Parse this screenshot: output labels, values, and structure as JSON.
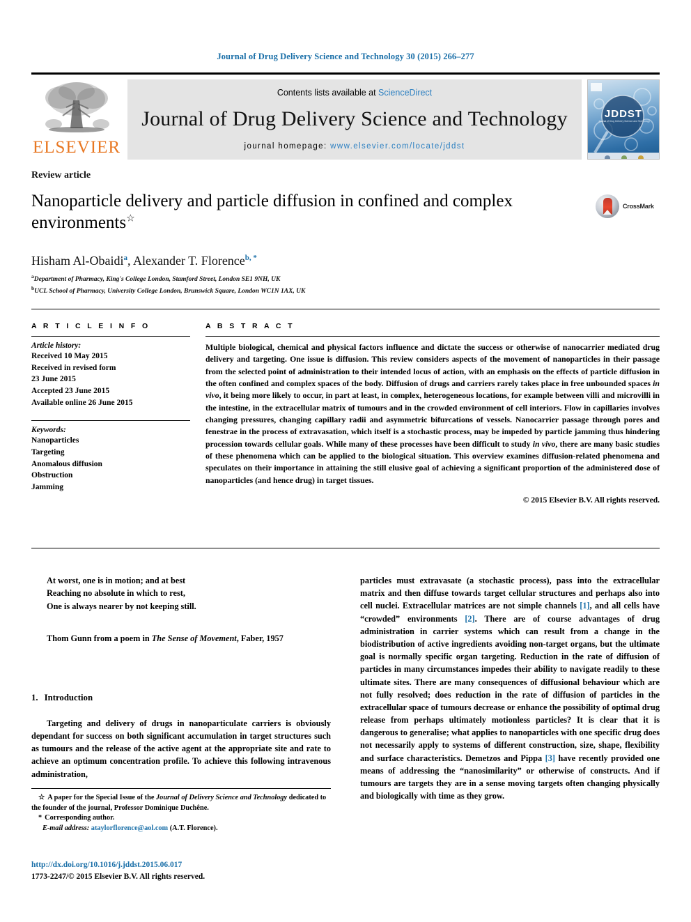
{
  "running_head": "Journal of Drug Delivery Science and Technology 30 (2015) 266–277",
  "masthead": {
    "publisher_name": "ELSEVIER",
    "publisher_logo_icon": "elsevier-tree-icon",
    "contents_prefix": "Contents lists available at ",
    "contents_link": "ScienceDirect",
    "journal_name": "Journal of Drug Delivery Science and Technology",
    "homepage_label": "journal homepage: ",
    "homepage_url": "www.elsevier.com/locate/jddst",
    "cover_title": "JDDST",
    "cover_subtitle": "Journal of Drug Delivery Science and Technology"
  },
  "article": {
    "type": "Review article",
    "title": "Nanoparticle delivery and particle diffusion in confined and complex environments",
    "title_footnote_marker": "☆",
    "crossmark_label": "CrossMark",
    "authors": [
      {
        "name": "Hisham Al-Obaidi",
        "marks": "a"
      },
      {
        "name": "Alexander T. Florence",
        "marks": "b, *"
      }
    ],
    "authors_line_separator": ", ",
    "affiliations": [
      {
        "marker": "a",
        "text": "Department of Pharmacy, King's College London, Stamford Street, London SE1 9NH, UK"
      },
      {
        "marker": "b",
        "text": "UCL School of Pharmacy, University College London, Brunswick Square, London WC1N 1AX, UK"
      }
    ]
  },
  "article_info": {
    "heading": "A R T I C L E  I N F O",
    "history_label": "Article history:",
    "history": [
      "Received 10 May 2015",
      "Received in revised form",
      "23 June 2015",
      "Accepted 23 June 2015",
      "Available online 26 June 2015"
    ],
    "keywords_label": "Keywords:",
    "keywords": [
      "Nanoparticles",
      "Targeting",
      "Anomalous diffusion",
      "Obstruction",
      "Jamming"
    ]
  },
  "abstract": {
    "heading": "A B S T R A C T",
    "paragraph_1": "Multiple biological, chemical and physical factors influence and dictate the success or otherwise of nanocarrier mediated drug delivery and targeting. One issue is diffusion. This review considers aspects of the movement of nanoparticles in their passage from the selected point of administration to their intended locus of action, with an emphasis on the effects of particle diffusion in the often confined and complex spaces of the body. Diffusion of drugs and carriers rarely takes place in free unbounded spaces ",
    "italic_1": "in vivo",
    "paragraph_2": ", it being more likely to occur, in part at least, in complex, heterogeneous locations, for example between villi and microvilli in the intestine, in the extracellular matrix of tumours and in the crowded environment of cell interiors. Flow in capillaries involves changing pressures, changing capillary radii and asymmetric bifurcations of vessels. Nanocarrier passage through pores and fenestrae in the process of extravasation, which itself is a stochastic process, may be impeded by particle jamming thus hindering procession towards cellular goals. While many of these processes have been difficult to study ",
    "italic_2": "in vivo",
    "paragraph_3": ", there are many basic studies of these phenomena which can be applied to the biological situation. This overview examines diffusion-related phenomena and speculates on their importance in attaining the still elusive goal of achieving a significant proportion of the administered dose of nanoparticles (and hence drug) in target tissues.",
    "copyright": "© 2015 Elsevier B.V. All rights reserved."
  },
  "epigraph": {
    "lines": [
      "At worst, one is in motion; and at best",
      "Reaching no absolute in which to rest,",
      "One is always nearer by not keeping still."
    ],
    "source_prefix": "Thom Gunn from a poem in ",
    "source_title": "The Sense of Movement",
    "source_suffix": ", Faber, 1957"
  },
  "introduction": {
    "number": "1.",
    "title": "Introduction",
    "paragraph": "Targeting and delivery of drugs in nanoparticulate carriers is obviously dependant for success on both significant accumulation in target structures such as tumours and the release of the active agent at the appropriate site and rate to achieve an optimum concentration profile. To achieve this following intravenous administration,"
  },
  "right_column": {
    "part_1": "particles must extravasate (a stochastic process), pass into the extracellular matrix and then diffuse towards target cellular structures and perhaps also into cell nuclei. Extracellular matrices are not simple channels ",
    "cite_1": "[1]",
    "part_2": ", and all cells have “crowded” environments ",
    "cite_2": "[2]",
    "part_3": ". There are of course advantages of drug administration in carrier systems which can result from a change in the biodistribution of active ingredients avoiding non-target organs, but the ultimate goal is normally specific organ targeting. Reduction in the rate of diffusion of particles in many circumstances impedes their ability to navigate readily to these ultimate sites. There are many consequences of diffusional behaviour which are not fully resolved; does reduction in the rate of diffusion of particles in the extracellular space of tumours decrease or enhance the possibility of optimal drug release from perhaps ultimately motionless particles? It is clear that it is dangerous to generalise; what applies to nanoparticles with one specific drug does not necessarily apply to systems of different construction, size, shape, flexibility and surface characteristics. Demetzos and Pippa ",
    "cite_3": "[3]",
    "part_4": " have recently provided one means of addressing the “nanosimilarity” or otherwise of constructs. And if tumours are targets they are in a sense moving targets often changing physically and biologically with time as they grow."
  },
  "footnotes": {
    "star_marker": "☆",
    "star_prefix": "A paper for the Special Issue of the ",
    "star_italic": "Journal of Delivery Science and Technology",
    "star_suffix": " dedicated to the founder of the journal, Professor Dominique Duchêne.",
    "corresponding_marker": "*",
    "corresponding_text": "Corresponding author.",
    "email_label": "E-mail address:",
    "email_address": "ataylorflorence@aol.com",
    "email_attribution": "(A.T. Florence)."
  },
  "publication_footer": {
    "doi": "http://dx.doi.org/10.1016/j.jddst.2015.06.017",
    "issn_line": "1773-2247/© 2015 Elsevier B.V. All rights reserved."
  },
  "colors": {
    "link_blue": "#1a6fa8",
    "sciencedirect_blue": "#2b7fc1",
    "elsevier_orange": "#e87722",
    "masthead_gray": "#e4e4e4"
  }
}
